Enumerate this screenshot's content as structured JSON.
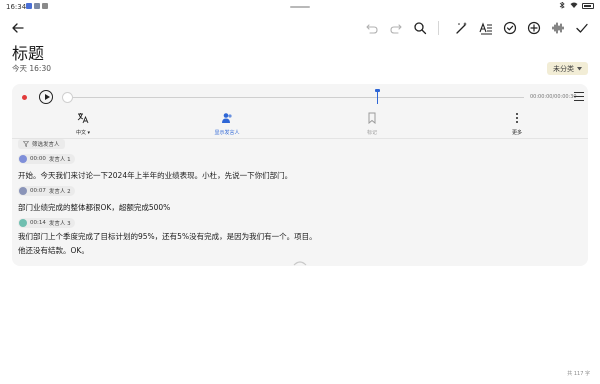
{
  "status_bar": {
    "time": "16:34"
  },
  "toolbar": {
    "back": "back-arrow-icon",
    "undo": "undo-icon",
    "redo": "redo-icon",
    "search": "search-icon",
    "tools": [
      "magic-wand-icon",
      "text-format-icon",
      "check-circle-icon",
      "plus-circle-icon",
      "waveform-icon",
      "check-icon"
    ]
  },
  "note": {
    "title": "标题",
    "time": "今天 16:30",
    "category": "未分类"
  },
  "player": {
    "time_label": "00:00:00/00:00:30",
    "progress": 0,
    "marker_progress": 0.68
  },
  "tabs": [
    {
      "label": "中文",
      "icon": "translate-icon"
    },
    {
      "label": "显示发言人",
      "icon": "speakers-icon"
    },
    {
      "label": "标记",
      "icon": "bookmark-icon"
    },
    {
      "label": "更多",
      "icon": "more-vertical-icon"
    }
  ],
  "filter": {
    "label": "筛选发言人"
  },
  "segments": [
    {
      "time": "00:00",
      "speaker": "发言人 1",
      "avatar_color": "#7f8fd9",
      "lines": [
        "开始。今天我们来讨论一下2024年上半年的业绩表现。小杜，先说一下你们部门。"
      ]
    },
    {
      "time": "00:07",
      "speaker": "发言人 2",
      "avatar_color": "#8a94b8",
      "lines": [
        "部门业绩完成的整体都很OK，超额完成500%"
      ]
    },
    {
      "time": "00:14",
      "speaker": "发言人 3",
      "avatar_color": "#6fbfb0",
      "lines": [
        "我们部门上个季度完成了目标计划的95%，还有5%没有完成，是因为我们有一个。项目。",
        "他还没有结款。OK。"
      ]
    }
  ],
  "footer": {
    "word_count": "共 117 字"
  }
}
